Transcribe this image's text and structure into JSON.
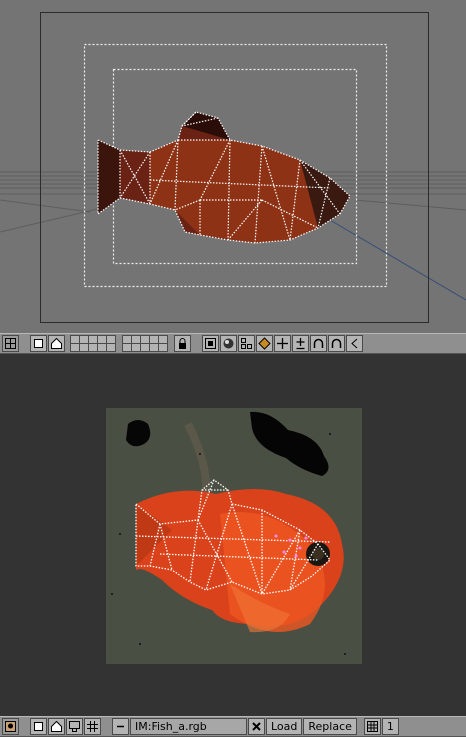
{
  "image_editor": {
    "image_name": "IM:Fish_a.rgb",
    "load_label": "Load",
    "replace_label": "Replace",
    "zoom_value": "1"
  },
  "icons": {
    "view3d_header": [
      "window-type-icon",
      "fullscreen-icon",
      "home-icon",
      "layer-buttons",
      "lock-icon",
      "draw-type-icon",
      "shading-icon",
      "proportional-icon",
      "snap-icon",
      "translate-icon",
      "scale-icon",
      "rotate-icon"
    ],
    "image_header": [
      "image-window-type-icon",
      "fullscreen-icon",
      "home-icon",
      "image-browse-icon",
      "grid-icon",
      "close-icon",
      "draw-mode-icon"
    ]
  },
  "colors": {
    "viewport_bg": "#747474",
    "image_bg": "#333333",
    "header_bg": "#8f8f8f",
    "fish_red": "#8a2a14",
    "fish_orange": "#e0481c"
  }
}
